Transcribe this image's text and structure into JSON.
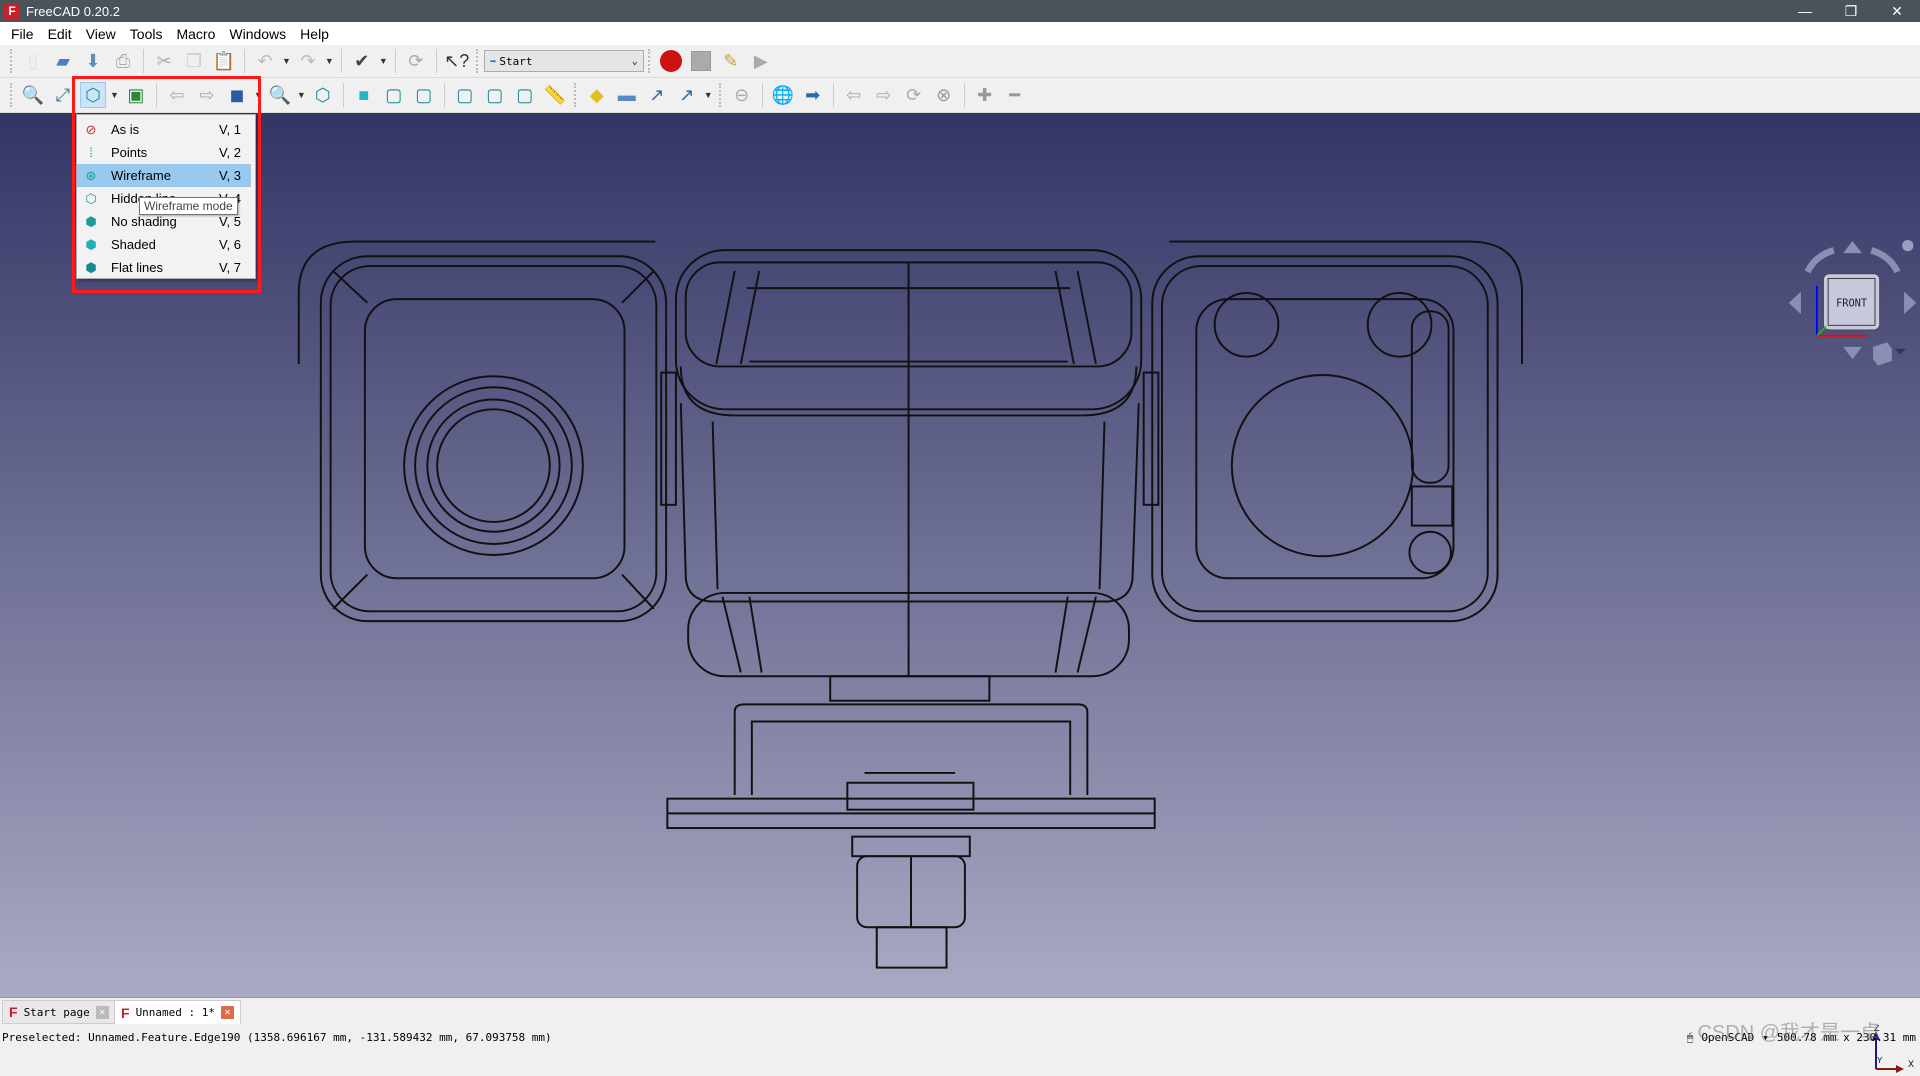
{
  "window": {
    "title": "FreeCAD 0.20.2",
    "logo": "freecad-logo",
    "controls": [
      "minimize",
      "restore",
      "close"
    ]
  },
  "menubar": [
    "File",
    "Edit",
    "View",
    "Tools",
    "Macro",
    "Windows",
    "Help"
  ],
  "toolbar": {
    "workbench": "Start",
    "macro_record_color": "#cc1111"
  },
  "draw_style_menu": {
    "items": [
      {
        "label": "As is",
        "shortcut": "V, 1",
        "icon": "as-is-icon"
      },
      {
        "label": "Points",
        "shortcut": "V, 2",
        "icon": "points-icon"
      },
      {
        "label": "Wireframe",
        "shortcut": "V, 3",
        "icon": "wireframe-icon",
        "selected": true
      },
      {
        "label": "Hidden line",
        "shortcut": "V, 4",
        "icon": "hidden-line-icon"
      },
      {
        "label": "No shading",
        "shortcut": "V, 5",
        "icon": "no-shading-icon"
      },
      {
        "label": "Shaded",
        "shortcut": "V, 6",
        "icon": "shaded-icon"
      },
      {
        "label": "Flat lines",
        "shortcut": "V, 7",
        "icon": "flat-lines-icon"
      }
    ],
    "tooltip": "Wireframe mode",
    "highlight_color": "#ff1a1a"
  },
  "navcube": {
    "face": "FRONT"
  },
  "axes": {
    "x": "X",
    "y": "Y",
    "z": "Z"
  },
  "tabs": [
    {
      "label": "Start page",
      "active": false
    },
    {
      "label": "Unnamed : 1*",
      "active": true
    }
  ],
  "status": {
    "preselected": "Preselected: Unnamed.Feature.Edge190 (1358.696167 mm, -131.589432 mm, 67.093758 mm)",
    "nav_style": "OpenSCAD",
    "dimensions": "500.78 mm x 230.31 mm"
  },
  "watermark": "CSDN @我才是一卓"
}
